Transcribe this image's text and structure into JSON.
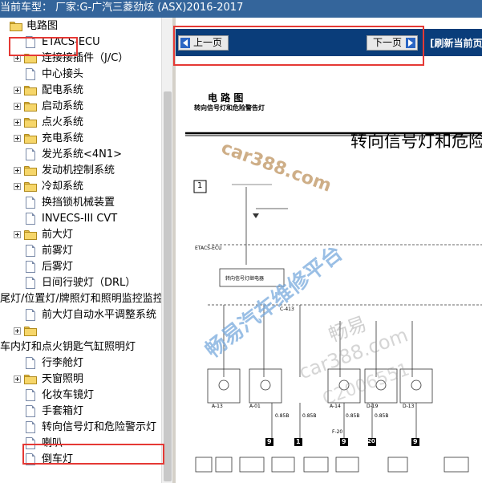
{
  "titlebar": {
    "label": "当前车型：",
    "value": "厂家:G-广汽三菱劲炫 (ASX)2016-2017"
  },
  "tree": {
    "items": [
      {
        "label": "电路图",
        "type": "folder-open"
      },
      {
        "label": "ETACS-ECU",
        "type": "page"
      },
      {
        "label": "连接接插件（J/C）",
        "type": "folder"
      },
      {
        "label": "中心接头",
        "type": "page"
      },
      {
        "label": "配电系统",
        "type": "folder"
      },
      {
        "label": "启动系统",
        "type": "folder"
      },
      {
        "label": "点火系统",
        "type": "folder"
      },
      {
        "label": "充电系统",
        "type": "folder"
      },
      {
        "label": "发光系统<4N1>",
        "type": "page"
      },
      {
        "label": "发动机控制系统",
        "type": "folder"
      },
      {
        "label": "冷却系统",
        "type": "folder"
      },
      {
        "label": "换挡锁机械装置",
        "type": "page"
      },
      {
        "label": "INVECS-III CVT",
        "type": "page"
      },
      {
        "label": "前大灯",
        "type": "folder"
      },
      {
        "label": "前雾灯",
        "type": "page"
      },
      {
        "label": "后雾灯",
        "type": "page"
      },
      {
        "label": "日间行驶灯（DRL）",
        "type": "page"
      },
      {
        "label": "尾灯/位置灯/牌照灯和照明监控监控器",
        "type": "page"
      },
      {
        "label": "前大灯自动水平调整系统",
        "type": "page"
      },
      {
        "label": "",
        "type": "folder"
      },
      {
        "label": "车内灯和点火钥匙气缸照明灯",
        "type": "page"
      },
      {
        "label": "行李舱灯",
        "type": "page"
      },
      {
        "label": "天窗照明",
        "type": "folder"
      },
      {
        "label": "化妆车镜灯",
        "type": "page"
      },
      {
        "label": "手套箱灯",
        "type": "page"
      },
      {
        "label": "转向信号灯和危险警示灯",
        "type": "page"
      },
      {
        "label": "喇叭",
        "type": "page"
      },
      {
        "label": "倒车灯",
        "type": "page"
      }
    ]
  },
  "viewer": {
    "prev_label": "上一页",
    "next_label": "下一页",
    "refresh_label": "[刷新当前页]"
  },
  "document": {
    "section_title": "电 路 图",
    "section_subtitle": "转向信号灯和危险警告灯",
    "main_title": "转向信号灯和危险",
    "box_number": "1",
    "ecu_label": "ETACS-ECU",
    "relay_label": "转向信号灯继电器",
    "connectors": [
      "A-13",
      "A-01",
      "A-14",
      "D-19",
      "D-13",
      "C-413"
    ],
    "wires": [
      "0.85B",
      "0.85B",
      "0.85B",
      "0.85B",
      "F-20"
    ],
    "grounds": [
      "9",
      "1",
      "9",
      "20",
      "9"
    ]
  },
  "watermarks": {
    "wm1": "car388.com",
    "wm2": "畅易汽车维修平台",
    "wm3": "畅易",
    "wm4": "car388.com",
    "wm5": "C2006551"
  },
  "colors": {
    "titlebar_bg": "#34659b",
    "navbar_bg": "#0a3d7a",
    "highlight": "#e53935"
  }
}
